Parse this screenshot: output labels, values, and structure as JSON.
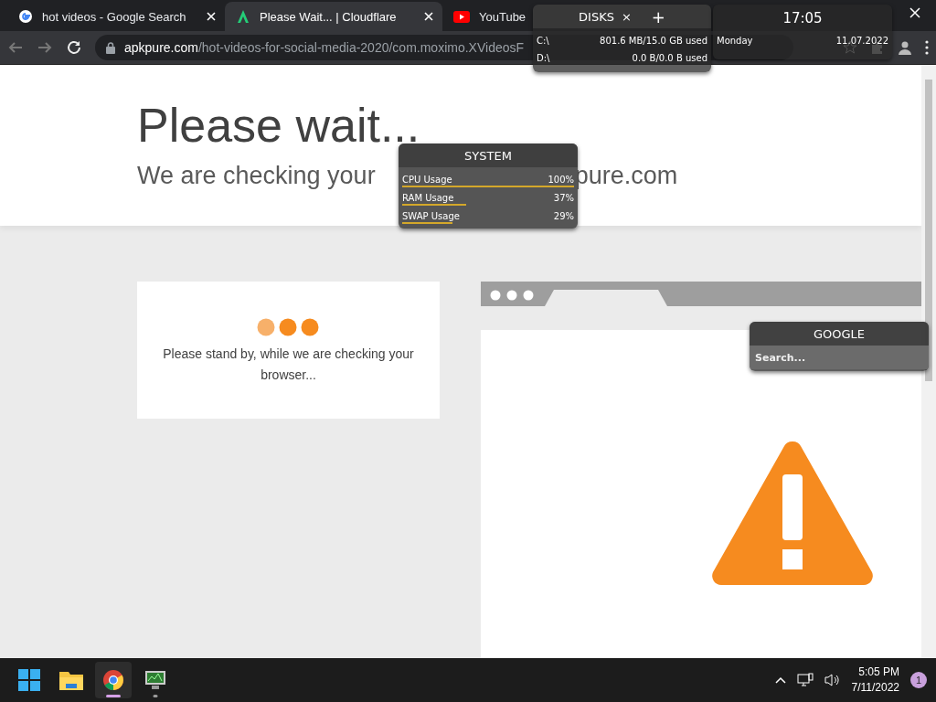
{
  "browser": {
    "tabs": [
      {
        "title": "hot videos - Google Search",
        "selected": false,
        "kind": "google"
      },
      {
        "title": "Please Wait... | Cloudflare",
        "selected": true,
        "kind": "apkpure"
      },
      {
        "title": "YouTube",
        "selected": false,
        "kind": "youtube"
      }
    ],
    "url": {
      "domain": "apkpure.com",
      "path": "/hot-videos-for-social-media-2020/com.moximo.XVideosF"
    }
  },
  "page": {
    "heading": "Please wait...",
    "subheading": [
      "We are checking your",
      "pure.com"
    ],
    "card_message": "Please stand by, while we are checking your browser..."
  },
  "widgets": {
    "disks": {
      "title": "DISKS",
      "close": "×",
      "add": "+",
      "drives": [
        {
          "name": "C:\\",
          "usage": "801.6 MB/15.0 GB used"
        },
        {
          "name": "D:\\",
          "usage": "0.0 B/0.0 B used"
        }
      ]
    },
    "clock": {
      "time": "17:05",
      "day": "Monday",
      "date": "11.07.2022"
    },
    "system": {
      "title": "SYSTEM",
      "meters": [
        {
          "label": "CPU Usage",
          "value": "100%",
          "level": 1.0
        },
        {
          "label": "RAM Usage",
          "value": "37%",
          "level": 0.37
        },
        {
          "label": "SWAP Usage",
          "value": "29%",
          "level": 0.29
        }
      ]
    },
    "google": {
      "title": "GOOGLE",
      "placeholder": "Search..."
    }
  },
  "taskbar": {
    "apps": [
      {
        "kind": "start",
        "selected": false,
        "running": false
      },
      {
        "kind": "folder",
        "selected": false,
        "running": false
      },
      {
        "kind": "chrome",
        "selected": true,
        "running": true
      },
      {
        "kind": "monitor",
        "selected": false,
        "running": true
      }
    ],
    "time": "5:05 PM",
    "date": "7/11/2022",
    "notifications": "1"
  }
}
